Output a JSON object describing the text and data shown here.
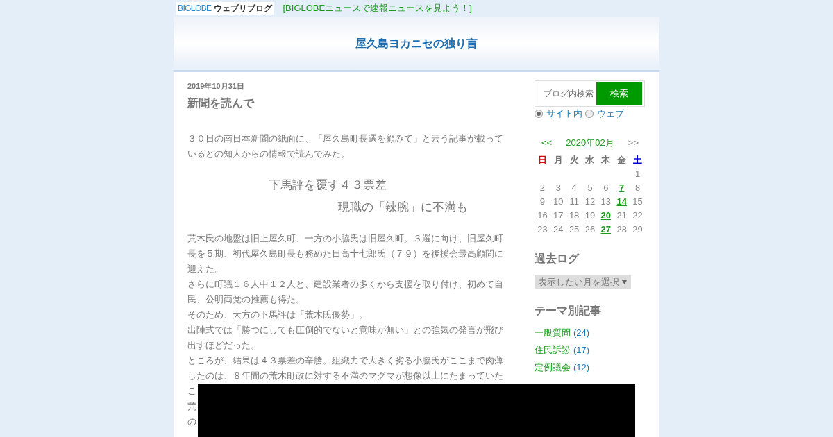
{
  "top_bar": {
    "logo_text": "BIGLOBE",
    "logo_sub": "ウェブリブログ",
    "news_link": "[BIGLOBEニュースで速報ニュースを見よう！]"
  },
  "blog_title": "屋久島ヨカニセの独り言",
  "post": {
    "date": "2019年10月31日",
    "title": "新聞を読んで",
    "intro": "３０日の南日本新聞の紙面に、「屋久島町長選を顧みて」と云う記事が載っているとの知人からの情報で読んでみた。",
    "headlines": [
      "下馬評を覆す４３票差",
      "現職の「辣腕」に不満も"
    ],
    "paragraphs": [
      "荒木氏の地盤は旧上屋久町、一方の小脇氏は旧屋久町。３選に向け、旧屋久町長を５期、初代屋久島町長も務めた日高十七郎氏（７９）を後援会最高顧問に迎えた。",
      "さらに町議１６人中１２人と、建設業者の多くから支援を取り付け、初めて自民、公明両党の推薦も得た。",
      "そのため、大方の下馬評は「荒木氏優勢」。",
      "出陣式では「勝つにしても圧倒的でないと意味が無い」との強気の発言が飛び出すほどだった。",
      "ところが、結果は４３票差の辛勝。組織力で大きく劣る小脇氏がここまで肉薄したのは、８年間の荒木町政に対する不満のマグマが想像以上にたまっていた",
      "こ",
      "荒",
      "の"
    ]
  },
  "sidebar": {
    "search": {
      "placeholder": "ブログ内検索",
      "button": "検索"
    },
    "scopes": [
      {
        "label": "サイト内",
        "selected": true
      },
      {
        "label": "ウェブ",
        "selected": false
      }
    ],
    "calendar": {
      "prev": "<<",
      "month": "2020年02月",
      "next": ">>",
      "weekdays": [
        {
          "label": "日",
          "kind": "sunday"
        },
        {
          "label": "月",
          "kind": "weekday"
        },
        {
          "label": "火",
          "kind": "weekday"
        },
        {
          "label": "水",
          "kind": "weekday"
        },
        {
          "label": "木",
          "kind": "weekday"
        },
        {
          "label": "金",
          "kind": "weekday"
        },
        {
          "label": "土",
          "kind": "saturday"
        }
      ],
      "weeks": [
        [
          {
            "day": "1",
            "linked": false
          }
        ],
        [
          {
            "day": "2",
            "linked": false
          },
          {
            "day": "3",
            "linked": false
          },
          {
            "day": "4",
            "linked": false
          },
          {
            "day": "5",
            "linked": false
          },
          {
            "day": "6",
            "linked": false
          },
          {
            "day": "7",
            "linked": true
          },
          {
            "day": "8",
            "linked": false
          }
        ],
        [
          {
            "day": "9",
            "linked": false
          },
          {
            "day": "10",
            "linked": false
          },
          {
            "day": "11",
            "linked": false
          },
          {
            "day": "12",
            "linked": false
          },
          {
            "day": "13",
            "linked": false
          },
          {
            "day": "14",
            "linked": true
          },
          {
            "day": "15",
            "linked": false
          }
        ],
        [
          {
            "day": "16",
            "linked": false
          },
          {
            "day": "17",
            "linked": false
          },
          {
            "day": "18",
            "linked": false
          },
          {
            "day": "19",
            "linked": false
          },
          {
            "day": "20",
            "linked": true
          },
          {
            "day": "21",
            "linked": false
          },
          {
            "day": "22",
            "linked": false
          }
        ],
        [
          {
            "day": "23",
            "linked": false
          },
          {
            "day": "24",
            "linked": false
          },
          {
            "day": "25",
            "linked": false
          },
          {
            "day": "26",
            "linked": false
          },
          {
            "day": "27",
            "linked": true
          },
          {
            "day": "28",
            "linked": false
          },
          {
            "day": "29",
            "linked": false
          }
        ]
      ]
    },
    "archive": {
      "heading": "過去ログ",
      "select": "表示したい月を選択"
    },
    "themes": {
      "heading": "テーマ別記事",
      "items": [
        {
          "label": "一般質問",
          "count": "(24)"
        },
        {
          "label": "住民訴訟",
          "count": "(17)"
        },
        {
          "label": "定例議会",
          "count": "(12)"
        }
      ]
    }
  }
}
